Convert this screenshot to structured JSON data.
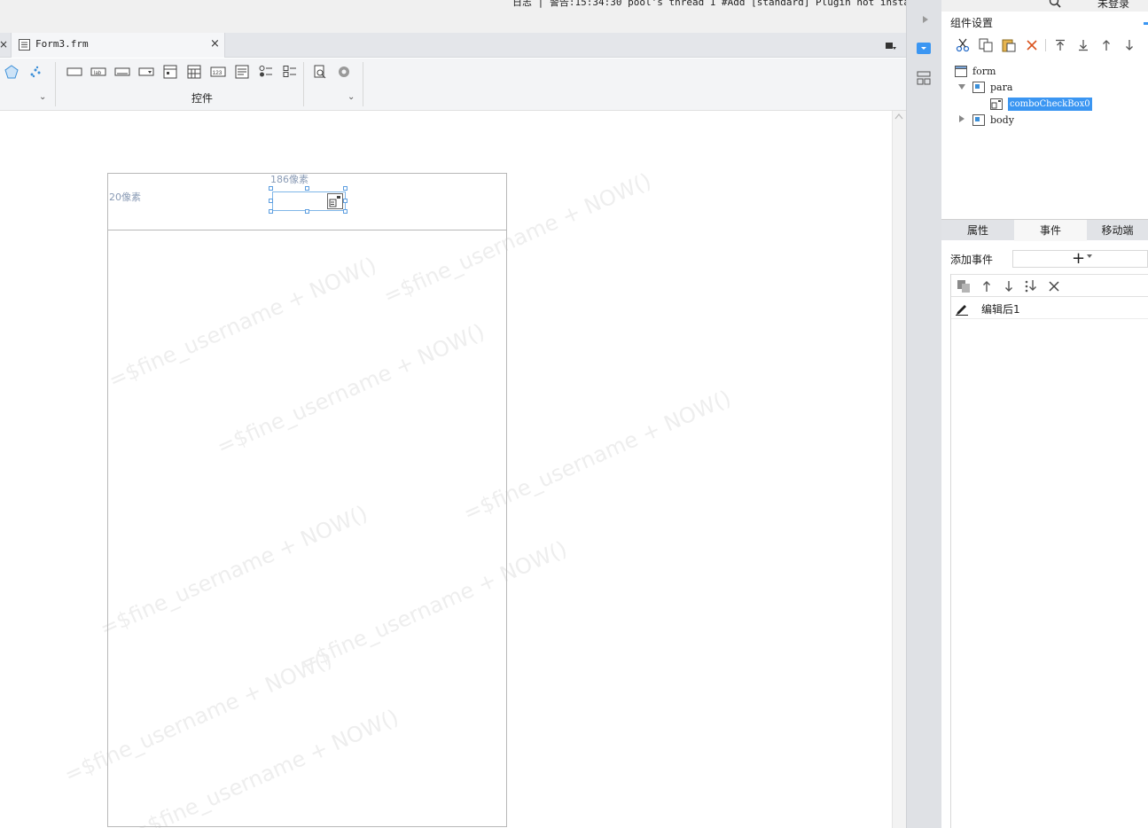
{
  "status_bar": {
    "log_text": "日志 | 警告:15:34:30 pool's thread 1 #Add [standard] Plugin not installed at designer end.Plugin ...",
    "login": "未登录"
  },
  "editor": {
    "tab_title": "Form3.frm",
    "tab_close": "×",
    "left_close": "×",
    "toolbar_group_label": "控件",
    "chevron": "⌄"
  },
  "canvas": {
    "ruler_y": "20像素",
    "ruler_x": "186像素",
    "watermark_text": "=$fine_username + NOW()"
  },
  "panel": {
    "title": "组件设置",
    "tree": [
      {
        "label": "form"
      },
      {
        "label": "para"
      },
      {
        "label": "comboCheckBox0",
        "selected": true
      },
      {
        "label": "body"
      }
    ],
    "tabs": [
      {
        "label": "属性"
      },
      {
        "label": "事件",
        "active": true
      },
      {
        "label": "移动端"
      }
    ],
    "add_event_label": "添加事件",
    "add_event_plus": "+",
    "events": [
      {
        "label": "编辑后1"
      }
    ]
  },
  "colors": {
    "accent": "#3b96f2",
    "selection_border": "#7fb6e8"
  }
}
